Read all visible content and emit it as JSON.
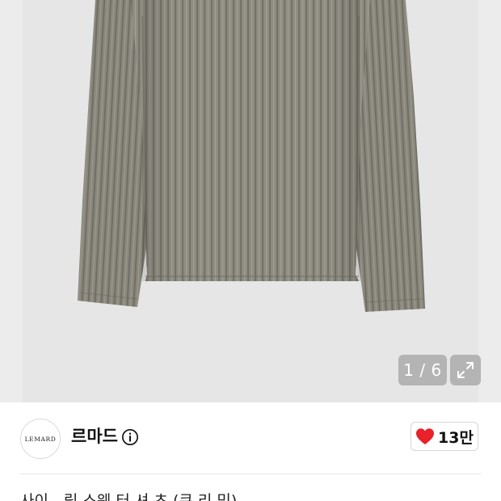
{
  "gallery": {
    "counter": "1 / 6",
    "photo_subject": "ribbed long-sleeve top, khaki grey",
    "expand_icon": "expand-arrows-icon"
  },
  "brand": {
    "logo_text": "LEMARD",
    "name": "르마드",
    "info_icon": "info-icon"
  },
  "like": {
    "icon": "heart-icon",
    "count": "13만",
    "color": "#e8212a"
  },
  "product": {
    "title_partial": "사이 - 립 스웨 터 셔 츠 (쿠 리 밍)"
  },
  "colors": {
    "garment": "#8e8b80",
    "garment_dark": "#6f6c63",
    "gallery_bg": "#e6e6e6"
  }
}
